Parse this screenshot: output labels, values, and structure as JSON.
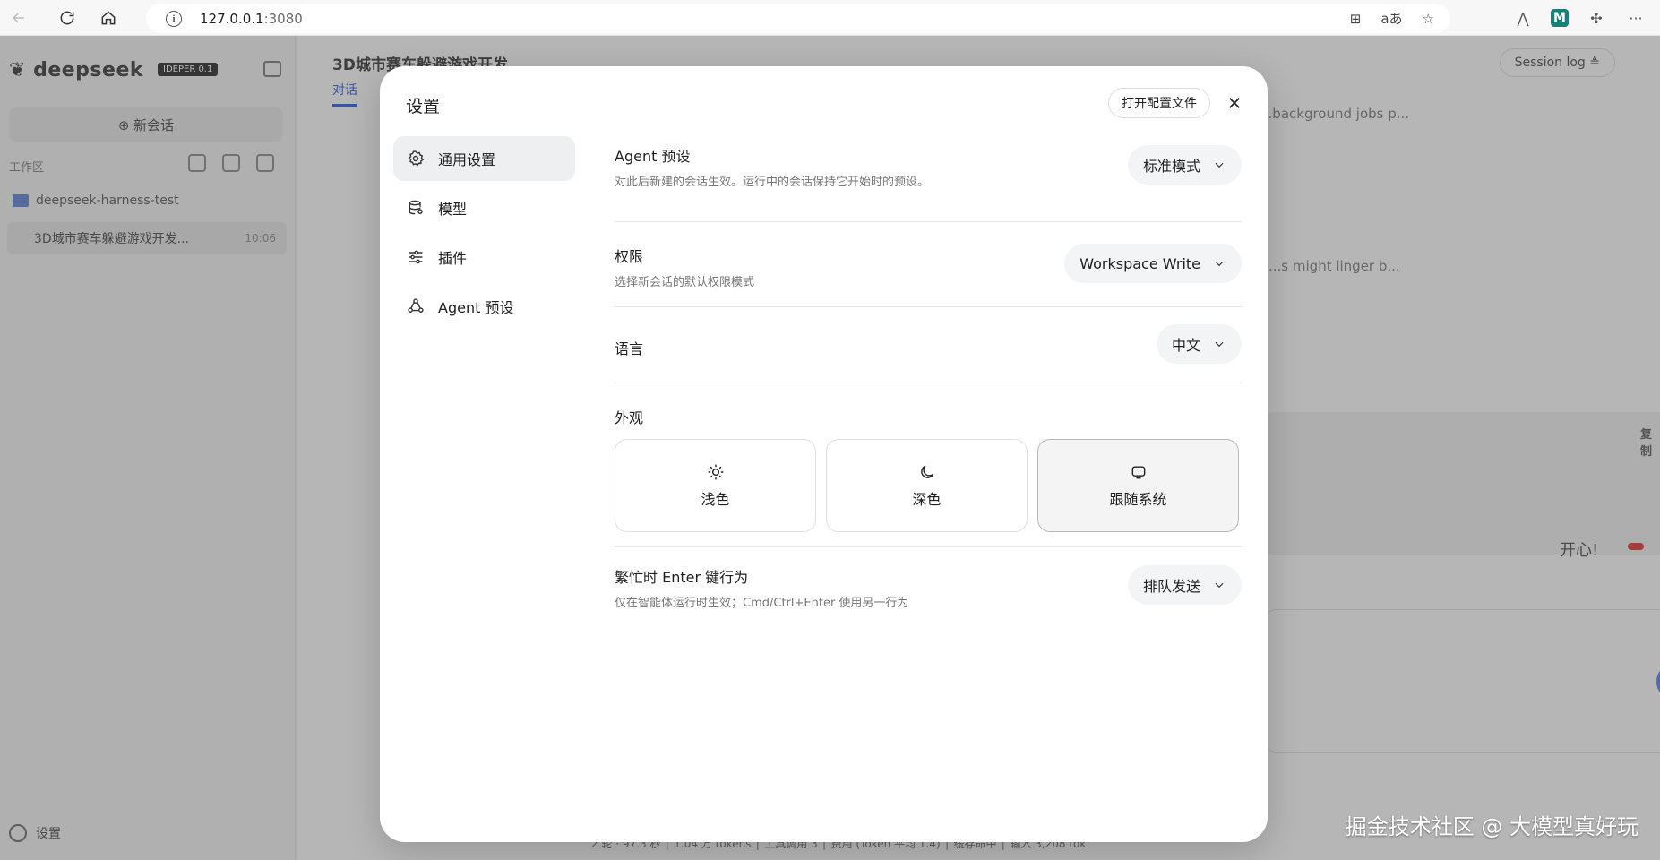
{
  "browser": {
    "url_host": "127.0.0.1",
    "url_port": ":3080",
    "translate_label": "aあ",
    "more_label": "···"
  },
  "app": {
    "logo_text": "deepseek",
    "logo_badge": "IDEPER 0.1",
    "new_chat_label": "⊕ 新会话",
    "workspace_label": "工作区",
    "project_name": "deepseek-harness-test",
    "chat_item_title": "3D城市赛车躲避游戏开发...",
    "chat_item_time": "10:06",
    "settings_link": "设置",
    "main_title": "3D城市赛车躲避游戏开发",
    "main_tab": "对话",
    "session_log": "Session log ≜",
    "main_lines": [
      "...background jobs p...",
      "...s might linger b..."
    ],
    "copy_label": "复制",
    "main_tail_text": "开心!",
    "status_bar": "2 轮 · 97.3 秒 │ 1.04 万 tokens │ 工具调用 3 │ 费用 (Token 平均 1.4) │ 缓存命中 │ 输入 3,208 tok"
  },
  "modal": {
    "title": "设置",
    "open_config_label": "打开配置文件",
    "nav": [
      {
        "label": "通用设置",
        "icon": "gear-icon",
        "active": true
      },
      {
        "label": "模型",
        "icon": "database-icon",
        "active": false
      },
      {
        "label": "插件",
        "icon": "sliders-icon",
        "active": false
      },
      {
        "label": "Agent 预设",
        "icon": "recycle-icon",
        "active": false
      }
    ],
    "agent_preset": {
      "title": "Agent 预设",
      "desc": "对此后新建的会话生效。运行中的会话保持它开始时的预设。",
      "value": "标准模式"
    },
    "permission": {
      "title": "权限",
      "desc": "选择新会话的默认权限模式",
      "value": "Workspace Write"
    },
    "language": {
      "title": "语言",
      "value": "中文"
    },
    "appearance": {
      "title": "外观",
      "options": [
        {
          "label": "浅色",
          "icon": "sun-icon",
          "selected": false
        },
        {
          "label": "深色",
          "icon": "moon-icon",
          "selected": false
        },
        {
          "label": "跟随系统",
          "icon": "monitor-icon",
          "selected": true
        }
      ]
    },
    "busy_enter": {
      "title": "繁忙时 Enter 键行为",
      "desc": "仅在智能体运行时生效；Cmd/Ctrl+Enter 使用另一行为",
      "value": "排队发送"
    }
  },
  "watermark": "掘金技术社区 @ 大模型真好玩"
}
